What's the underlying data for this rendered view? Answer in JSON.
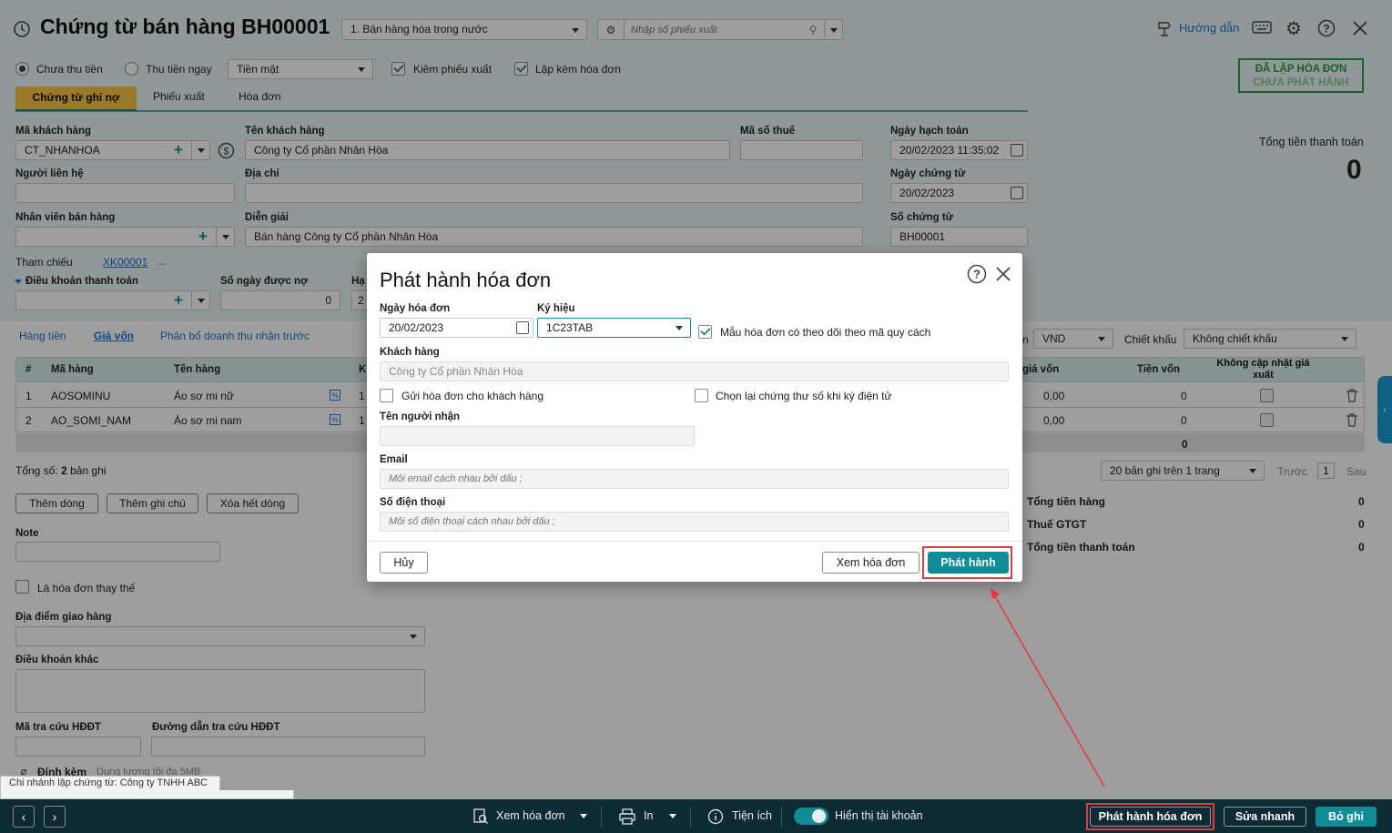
{
  "header": {
    "title": "Chứng từ bán hàng BH00001",
    "sale_type": "1. Bán hàng hóa trong nước",
    "search_placeholder": "Nhập số phiếu xuất",
    "guide_label": "Hướng dẫn"
  },
  "options": {
    "unpaid": "Chưa thu tiền",
    "paid": "Thu tiền ngay",
    "pay_method": "Tiền mặt",
    "cb_export": "Kiêm phiếu xuất",
    "cb_invoice": "Lập kèm hóa đơn"
  },
  "status_stamp": {
    "line1": "ĐÃ LẬP HÓA ĐƠN",
    "line2": "CHƯA PHÁT HÀNH"
  },
  "tabs": [
    "Chứng từ ghi nợ",
    "Phiếu xuất",
    "Hóa đơn"
  ],
  "form": {
    "customer_code_label": "Mã khách hàng",
    "customer_code": "CT_NHANHOA",
    "customer_name_label": "Tên khách hàng",
    "customer_name": "Công ty Cổ phần Nhân Hòa",
    "tax_label": "Mã số thuế",
    "contact_label": "Người liên hệ",
    "address_label": "Địa chỉ",
    "staff_label": "Nhân viên bán hàng",
    "desc_label": "Diễn giải",
    "desc": "Bán hàng Công ty Cổ phần Nhân Hòa",
    "ref_label": "Tham chiếu",
    "ref_value": "XK00001",
    "ref_more": "...",
    "pay_terms_label": "Điều khoản thanh toán",
    "debt_days_label": "Số ngày được nợ",
    "debt_days": "0",
    "due_label": "Hạ",
    "due_value": "2",
    "acc_date_label": "Ngày hạch toán",
    "acc_date": "20/02/2023 11:35:02",
    "doc_date_label": "Ngày chứng từ",
    "doc_date": "20/02/2023",
    "doc_no_label": "Số chứng từ",
    "doc_no": "BH00001"
  },
  "total": {
    "label": "Tổng tiền thanh toán",
    "value": "0"
  },
  "subtabs": [
    "Hàng tiền",
    "Giá vốn",
    "Phân bổ doanh thu nhận trước"
  ],
  "currency_label": "n",
  "currency": "VND",
  "discount_label": "Chiết khấu",
  "discount": "Không chiết khấu",
  "table": {
    "headers": [
      "#",
      "Mã hàng",
      "Tên hàng",
      "K",
      "giá vốn",
      "Tiền vốn",
      "Không cập nhật giá",
      "xuất"
    ],
    "rows": [
      {
        "no": "1",
        "code": "AOSOMINU",
        "name": "Áo sơ mi nữ",
        "k": "1",
        "cost_price": "0,00",
        "cost": "0"
      },
      {
        "no": "2",
        "code": "AO_SOMI_NAM",
        "name": "Áo sơ mi nam",
        "k": "1",
        "cost_price": "0,00",
        "cost": "0"
      }
    ],
    "footer_total": "0"
  },
  "records": {
    "label": "Tổng số:",
    "count": "2",
    "suffix": "bản ghi"
  },
  "pager": {
    "size": "20 bản ghi trên 1 trang",
    "prev": "Trước",
    "page": "1",
    "next": "Sau"
  },
  "row_buttons": [
    "Thêm dòng",
    "Thêm ghi chú",
    "Xóa hết dòng"
  ],
  "summary": [
    {
      "label": "Tổng tiền hàng",
      "value": "0"
    },
    {
      "label": "Thuế GTGT",
      "value": "0"
    },
    {
      "label": "Tổng tiền thanh toán",
      "value": "0"
    }
  ],
  "lower": {
    "note_label": "Note",
    "replace_label": "Là hóa đơn thay thế",
    "delivery_label": "Địa điểm giao hàng",
    "other_terms_label": "Điều khoản khác",
    "lookup_code_label": "Mã tra cứu HĐĐT",
    "lookup_url_label": "Đường dẫn tra cứu HĐĐT",
    "attach_label": "Đính kèm",
    "attach_hint": "Dung lượng tối đa 5MB",
    "branch_tip": "Chi nhánh lập chứng từ: Công ty TNHH ABC"
  },
  "modal": {
    "title": "Phát hành hóa đơn",
    "date_label": "Ngày hóa đơn",
    "date": "20/02/2023",
    "symbol_label": "Ký hiệu",
    "symbol": "1C23TAB",
    "track_label": "Mẫu hóa đơn có theo dõi theo mã quy cách",
    "customer_label": "Khách hàng",
    "customer": "Công ty Cổ phần Nhân Hòa",
    "send_label": "Gửi hóa đơn cho khách hàng",
    "cert_label": "Chọn lại chứng thư số khi ký điện tử",
    "receiver_label": "Tên người nhận",
    "email_label": "Email",
    "email_placeholder": "Mỗi email cách nhau bởi dấu ;",
    "phone_label": "Số điện thoại",
    "phone_placeholder": "Mỗi số điện thoại cách nhau bởi dấu ;",
    "cancel": "Hủy",
    "preview": "Xem hóa đơn",
    "publish": "Phát hành"
  },
  "bottom_bar": {
    "view_invoice": "Xem hóa đơn",
    "print": "In",
    "utilities": "Tiện ích",
    "show_account": "Hiển thị tài khoản",
    "publish": "Phát hành hóa đơn",
    "quick_edit": "Sửa nhanh",
    "discard": "Bỏ ghi"
  },
  "colors": {
    "accent": "#0f8c98",
    "highlight": "#e5393b",
    "bar": "#0e2a35"
  }
}
